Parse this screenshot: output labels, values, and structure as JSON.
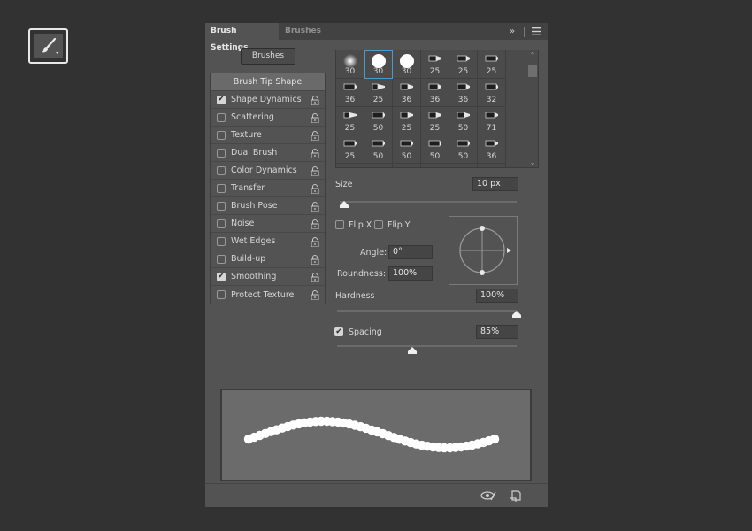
{
  "tabs": [
    {
      "label": "Brush Settings",
      "active": true
    },
    {
      "label": "Brushes",
      "active": false
    }
  ],
  "brushes_button": "Brushes",
  "options": [
    {
      "label": "Brush Tip Shape",
      "header": true
    },
    {
      "label": "Shape Dynamics",
      "checked": true
    },
    {
      "label": "Scattering",
      "checked": false
    },
    {
      "label": "Texture",
      "checked": false
    },
    {
      "label": "Dual Brush",
      "checked": false
    },
    {
      "label": "Color Dynamics",
      "checked": false
    },
    {
      "label": "Transfer",
      "checked": false
    },
    {
      "label": "Brush Pose",
      "checked": false
    },
    {
      "label": "Noise",
      "checked": false
    },
    {
      "label": "Wet Edges",
      "checked": false
    },
    {
      "label": "Build-up",
      "checked": false
    },
    {
      "label": "Smoothing",
      "checked": true
    },
    {
      "label": "Protect Texture",
      "checked": false
    }
  ],
  "presets": [
    {
      "size": "30",
      "shape": "soft-round"
    },
    {
      "size": "30",
      "shape": "hard-round",
      "selected": true
    },
    {
      "size": "30",
      "shape": "hard-round"
    },
    {
      "size": "25",
      "shape": "tip-a"
    },
    {
      "size": "25",
      "shape": "tip-b"
    },
    {
      "size": "25",
      "shape": "tip-c"
    },
    {
      "size": "36",
      "shape": "tip-c"
    },
    {
      "size": "25",
      "shape": "tip-d"
    },
    {
      "size": "36",
      "shape": "tip-e"
    },
    {
      "size": "36",
      "shape": "tip-f"
    },
    {
      "size": "36",
      "shape": "tip-f"
    },
    {
      "size": "32",
      "shape": "tip-g"
    },
    {
      "size": "25",
      "shape": "tip-h"
    },
    {
      "size": "50",
      "shape": "tip-g"
    },
    {
      "size": "25",
      "shape": "tip-i"
    },
    {
      "size": "25",
      "shape": "tip-i"
    },
    {
      "size": "50",
      "shape": "tip-i"
    },
    {
      "size": "71",
      "shape": "tip-j"
    },
    {
      "size": "25",
      "shape": "tip-k"
    },
    {
      "size": "50",
      "shape": "tip-k"
    },
    {
      "size": "50",
      "shape": "tip-k"
    },
    {
      "size": "50",
      "shape": "tip-k"
    },
    {
      "size": "50",
      "shape": "tip-k"
    },
    {
      "size": "36",
      "shape": "tip-f"
    }
  ],
  "size": {
    "label": "Size",
    "value": "10 px",
    "level": 0.0
  },
  "flip_x": {
    "label": "Flip X",
    "checked": false
  },
  "flip_y": {
    "label": "Flip Y",
    "checked": false
  },
  "angle": {
    "label": "Angle:",
    "value": "0°"
  },
  "roundness": {
    "label": "Roundness:",
    "value": "100%"
  },
  "hardness": {
    "label": "Hardness",
    "value": "100%",
    "level": 1.0
  },
  "spacing": {
    "label": "Spacing",
    "value": "85%",
    "checked": true,
    "level": 0.42
  },
  "colors": {
    "panel": "#535353",
    "background": "#323232",
    "accent": "#4a9ad0"
  }
}
